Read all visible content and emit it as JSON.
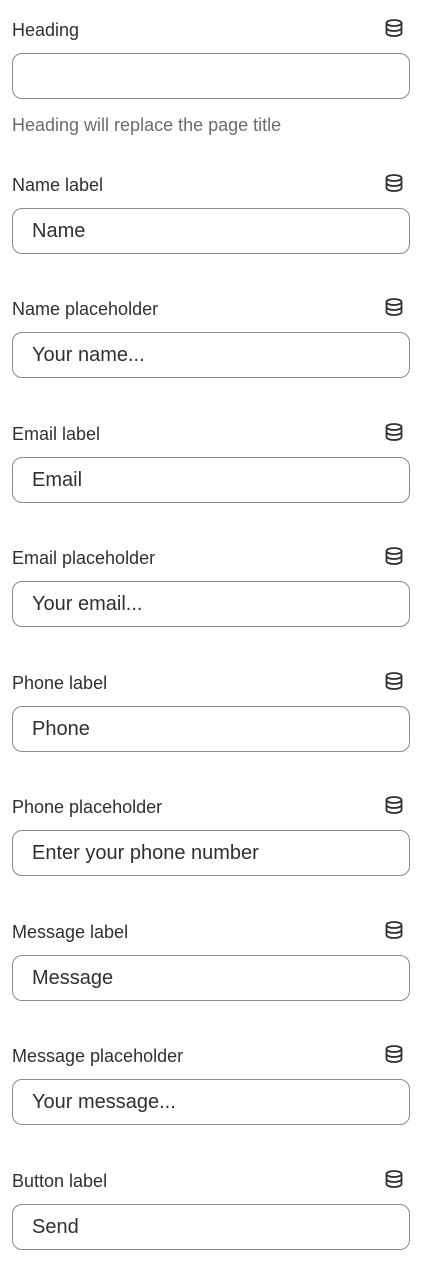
{
  "fields": [
    {
      "label": "Heading",
      "value": "",
      "help": "Heading will replace the page title"
    },
    {
      "label": "Name label",
      "value": "Name"
    },
    {
      "label": "Name placeholder",
      "value": "Your name..."
    },
    {
      "label": "Email label",
      "value": "Email"
    },
    {
      "label": "Email placeholder",
      "value": "Your email..."
    },
    {
      "label": "Phone label",
      "value": "Phone"
    },
    {
      "label": "Phone placeholder",
      "value": "Enter your phone number"
    },
    {
      "label": "Message label",
      "value": "Message"
    },
    {
      "label": "Message placeholder",
      "value": "Your message..."
    },
    {
      "label": "Button label",
      "value": "Send"
    }
  ],
  "icons": {
    "dynamic_source": "database-icon"
  },
  "colors": {
    "text": "#303030",
    "help_text": "#6b6b6b",
    "input_border": "#8a8a8a"
  }
}
